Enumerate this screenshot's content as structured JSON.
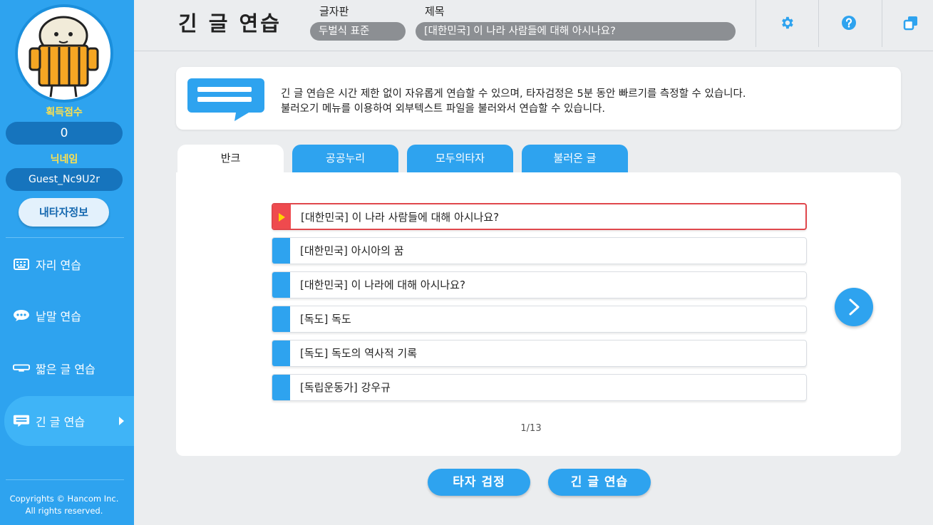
{
  "sidebar": {
    "score_label": "획득점수",
    "score_value": "0",
    "nickname_label": "닉네임",
    "nickname_value": "Guest_Nc9U2r",
    "my_info_button": "내타자정보",
    "nav": [
      {
        "label": "자리 연습",
        "icon": "keyboard-icon"
      },
      {
        "label": "낱말 연습",
        "icon": "speech-bubble-icon"
      },
      {
        "label": "짧은 글 연습",
        "icon": "short-text-icon"
      },
      {
        "label": "긴 글 연습",
        "icon": "long-text-icon",
        "active": true
      }
    ],
    "copyright_line1": "Copyrights © Hancom Inc.",
    "copyright_line2": "All rights reserved."
  },
  "header": {
    "title": "긴 글 연습",
    "keyboard_label": "글자판",
    "keyboard_value": "두벌식 표준",
    "subject_label": "제목",
    "subject_value": "[대한민국] 이 나라 사람들에 대해 아시나요?"
  },
  "info": {
    "line1": "긴 글 연습은 시간 제한 없이 자유롭게 연습할 수 있으며, 타자검정은 5분 동안 빠르기를 측정할 수 있습니다.",
    "line2": "불러오기 메뉴를 이용하여 외부텍스트 파일을 불러와서 연습할 수 있습니다."
  },
  "tabs": [
    {
      "label": "반크",
      "active": true
    },
    {
      "label": "공공누리",
      "active": false
    },
    {
      "label": "모두의타자",
      "active": false
    },
    {
      "label": "불러온 글",
      "active": false
    }
  ],
  "items": [
    {
      "label": "[대한민국] 이 나라 사람들에 대해 아시나요?",
      "selected": true
    },
    {
      "label": "[대한민국] 아시아의 꿈",
      "selected": false
    },
    {
      "label": "[대한민국] 이 나라에 대해 아시나요?",
      "selected": false
    },
    {
      "label": "[독도] 독도",
      "selected": false
    },
    {
      "label": "[독도] 독도의 역사적 기록",
      "selected": false
    },
    {
      "label": "[독립운동가] 강우규",
      "selected": false
    }
  ],
  "pager": "1/13",
  "buttons": {
    "typing_test": "타자 검정",
    "long_practice": "긴 글 연습"
  },
  "colors": {
    "sidebar": "#2ea3ef",
    "accent_red": "#e0474c",
    "label_yellow": "#ffe14d"
  }
}
